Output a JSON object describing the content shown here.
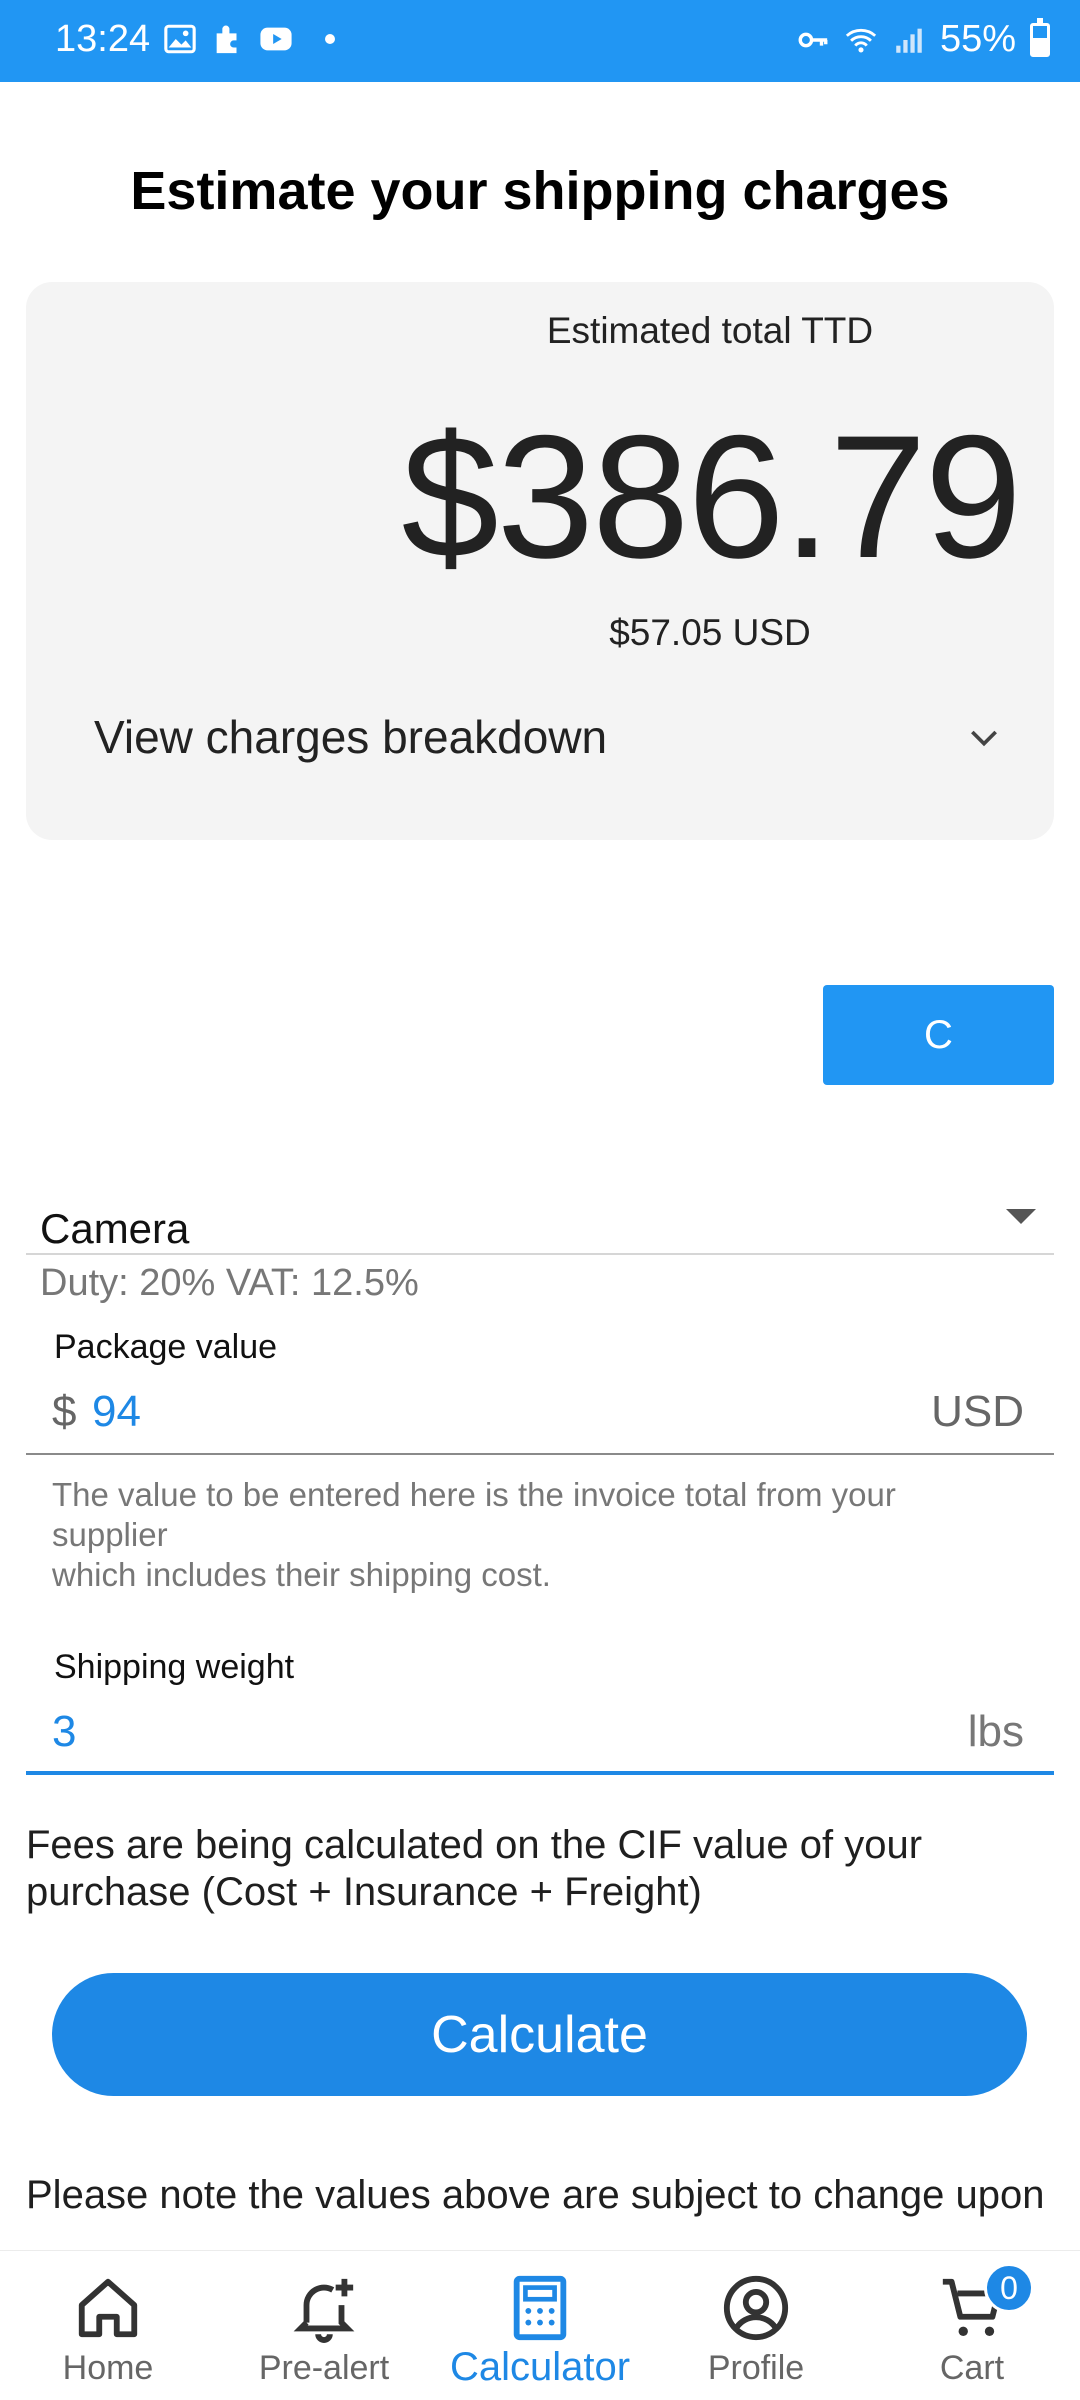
{
  "status_bar": {
    "time": "13:24",
    "battery": "55%",
    "left_icons": [
      "gallery-icon",
      "puzzle-icon",
      "youtube-icon"
    ],
    "right_icons": [
      "key-icon",
      "wifi-icon",
      "signal-icon",
      "battery-icon"
    ]
  },
  "page": {
    "title": "Estimate your shipping charges"
  },
  "estimate": {
    "label": "Estimated total TTD",
    "total": "$386.79",
    "usd": "$57.05 USD",
    "breakdown_label": "View charges breakdown"
  },
  "c_button": {
    "label": "C"
  },
  "category": {
    "value": "Camera",
    "duty": "Duty: 20% VAT: 12.5%"
  },
  "package_value": {
    "label": "Package value",
    "prefix": "$",
    "value": "94",
    "suffix": "USD",
    "helper": "The value to be entered here is the invoice total from your supplier\n which includes their shipping cost."
  },
  "shipping_weight": {
    "label": "Shipping weight",
    "value": "3",
    "suffix": "lbs"
  },
  "cif_note": "Fees are being calculated on the CIF value of your purchase (Cost + Insurance + Freight)",
  "calculate_label": "Calculate",
  "disclaimer": "Please note the values above are subject to change upon",
  "nav": {
    "items": [
      {
        "label": "Home",
        "icon": "home-icon"
      },
      {
        "label": "Pre-alert",
        "icon": "bell-plus-icon"
      },
      {
        "label": "Calculator",
        "icon": "calculator-icon",
        "active": true
      },
      {
        "label": "Profile",
        "icon": "profile-icon"
      },
      {
        "label": "Cart",
        "icon": "cart-icon",
        "badge": "0"
      }
    ]
  },
  "colors": {
    "primary": "#2196f3",
    "accent": "#1e88e5",
    "card_bg": "#f4f4f4"
  }
}
